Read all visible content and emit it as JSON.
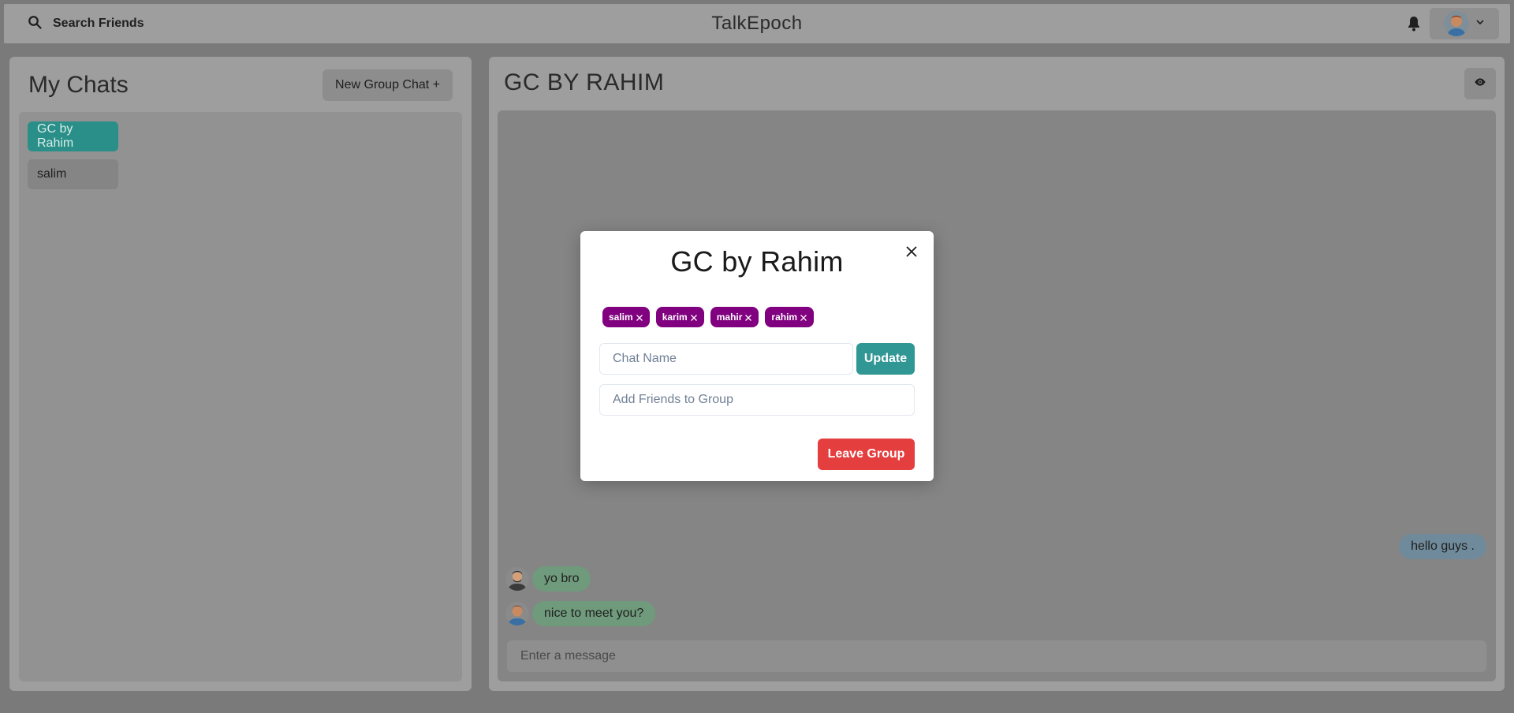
{
  "header": {
    "search_label": "Search Friends",
    "app_title": "TalkEpoch"
  },
  "sidebar": {
    "title": "My Chats",
    "new_group_label": "New Group Chat +",
    "chats": [
      {
        "label": "GC by Rahim",
        "active": true
      },
      {
        "label": "salim",
        "active": false
      }
    ]
  },
  "chat": {
    "title": "GC BY RAHIM",
    "messages": [
      {
        "text": "hello guys .",
        "side": "right"
      },
      {
        "text": "yo bro",
        "side": "left"
      },
      {
        "text": "nice to meet you?",
        "side": "left"
      }
    ],
    "input_placeholder": "Enter a message"
  },
  "modal": {
    "title": "GC by Rahim",
    "members": [
      "salim",
      "karim",
      "mahir",
      "rahim"
    ],
    "chat_name_placeholder": "Chat Name",
    "update_label": "Update",
    "add_friends_placeholder": "Add Friends to Group",
    "leave_label": "Leave Group"
  },
  "colors": {
    "accent_teal": "#319795",
    "badge_purple": "#800080",
    "danger_red": "#e53e3e"
  },
  "icons": {
    "search": "search-icon",
    "bell": "bell-icon",
    "chevron": "chevron-down-icon",
    "eye": "eye-icon",
    "close": "close-icon"
  }
}
